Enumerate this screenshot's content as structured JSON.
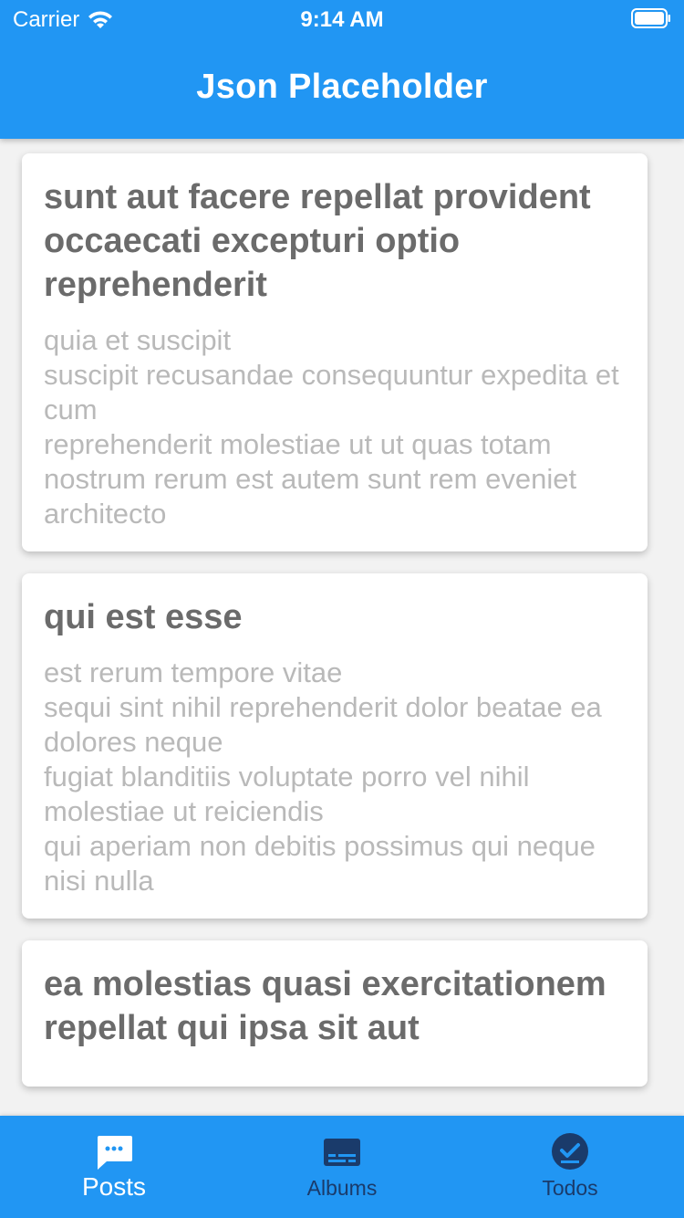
{
  "status_bar": {
    "carrier": "Carrier",
    "time": "9:14 AM"
  },
  "app_bar": {
    "title": "Json Placeholder",
    "color": "#2196f3"
  },
  "posts": [
    {
      "title": "sunt aut facere repellat provident occaecati excepturi optio reprehenderit",
      "body": "quia et suscipit\nsuscipit recusandae consequuntur expedita et cum\nreprehenderit molestiae ut ut quas totam\nnostrum rerum est autem sunt rem eveniet architecto"
    },
    {
      "title": "qui est esse",
      "body": "est rerum tempore vitae\nsequi sint nihil reprehenderit dolor beatae ea dolores neque\nfugiat blanditiis voluptate porro vel nihil molestiae ut reiciendis\nqui aperiam non debitis possimus qui neque nisi nulla"
    },
    {
      "title": "ea molestias quasi exercitationem repellat qui ipsa sit aut",
      "body": ""
    }
  ],
  "bottom_nav": {
    "items": [
      {
        "label": "Posts",
        "icon": "chat-bubble-icon",
        "active": true
      },
      {
        "label": "Albums",
        "icon": "album-icon",
        "active": false
      },
      {
        "label": "Todos",
        "icon": "check-circle-icon",
        "active": false
      }
    ]
  }
}
